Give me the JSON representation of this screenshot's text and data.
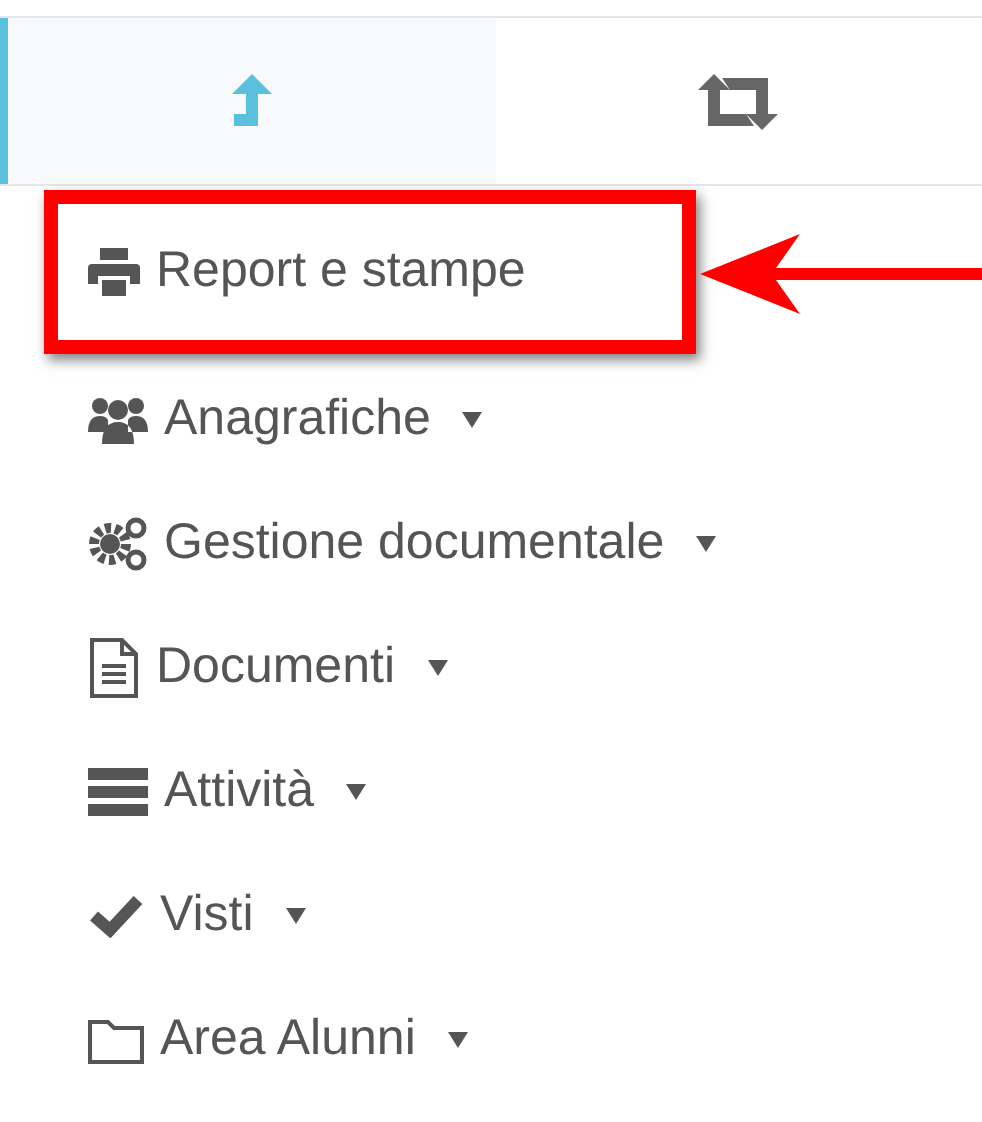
{
  "tabs": [
    {
      "selected": true
    },
    {
      "selected": false
    }
  ],
  "menu": {
    "items": [
      {
        "label": "Report e stampe",
        "has_submenu": false,
        "highlighted": true
      },
      {
        "label": "Anagrafiche",
        "has_submenu": true,
        "highlighted": false
      },
      {
        "label": "Gestione documentale",
        "has_submenu": true,
        "highlighted": false
      },
      {
        "label": "Documenti",
        "has_submenu": true,
        "highlighted": false
      },
      {
        "label": "Attività",
        "has_submenu": true,
        "highlighted": false
      },
      {
        "label": "Visti",
        "has_submenu": true,
        "highlighted": false
      },
      {
        "label": "Area Alunni",
        "has_submenu": true,
        "highlighted": false
      }
    ]
  }
}
